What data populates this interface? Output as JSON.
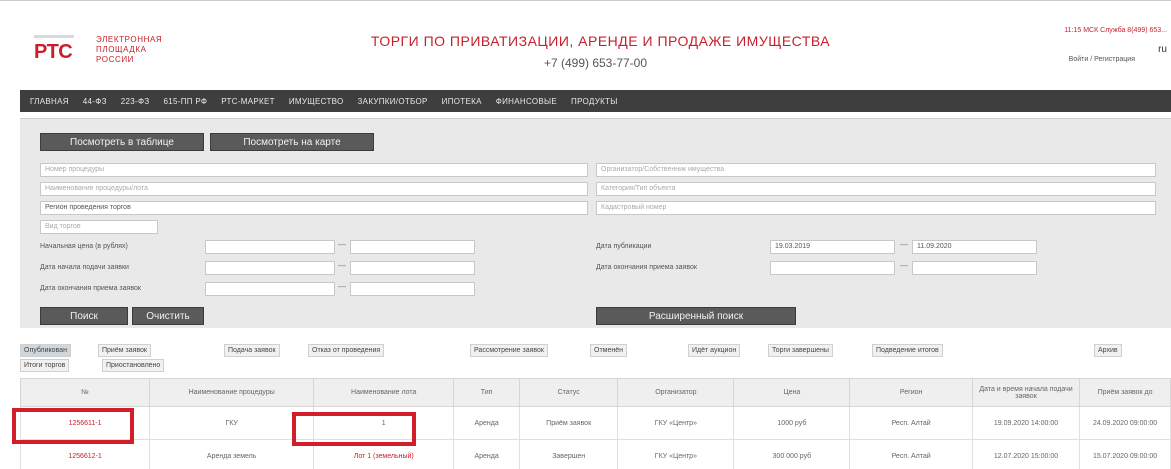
{
  "header": {
    "logo_mark": "РТС",
    "logo_text": [
      "ЭЛЕКТРОННАЯ",
      "ПЛОЩАДКА",
      "РОССИИ"
    ],
    "title": "ТОРГИ ПО ПРИВАТИЗАЦИИ, АРЕНДЕ И ПРОДАЖЕ ИМУЩЕСТВА",
    "phone": "+7 (499) 653-77-00",
    "top_right": "11:15 МСК  Служба 8(499) 653...",
    "lang": "ru",
    "login": "Войти / Регистрация"
  },
  "nav": [
    "ГЛАВНАЯ",
    "44-ФЗ",
    "223-ФЗ",
    "615-ПП РФ",
    "РТС-МАРКЕТ",
    "ИМУЩЕСТВО",
    "ЗАКУПКИ/ОТБОР",
    "ИПОТЕКА",
    "ФИНАНСОВЫЕ",
    "ПРОДУКТЫ"
  ],
  "filters": {
    "table_button": "Посмотреть в таблице",
    "map_button": "Посмотреть на карте",
    "left_fields": [
      "Номер процедуры",
      "Наименование процедуры/лота",
      "Регион проведения торгов",
      "Вид торгов"
    ],
    "right_fields": [
      "Организатор/Собственник имущества",
      "Категория/Тип объекта",
      "Кадастровый номер"
    ],
    "row_labels_left": [
      "Начальная цена (в рублях)",
      "Дата начала подачи заявки",
      "Дата окончания приема заявок"
    ],
    "row_labels_right": [
      "Дата публикации",
      "Дата окончания приема заявок"
    ],
    "date_from": "19.03.2019",
    "date_to": "11.09.2020",
    "search_button": "Поиск",
    "clear_button": "Очистить",
    "advanced_button": "Расширенный поиск"
  },
  "tabs": [
    "Опубликован",
    "Приём заявок",
    "Подача заявок",
    "Отказ от проведения",
    "Рассмотрение заявок",
    "Отменён",
    "Идёт аукцион",
    "Торги завершены",
    "Подведение итогов",
    "Архив",
    "Итоги торгов",
    "Приостановлено"
  ],
  "table": {
    "headers": [
      "№",
      "Наименование процедуры",
      "Наименование лота",
      "Тип",
      "Статус",
      "Организатор",
      "Цена",
      "Регион",
      "Дата и время начала подачи заявок",
      "Приём заявок до"
    ],
    "rows": [
      [
        "1256611-1",
        "ГКУ",
        "1",
        "Аренда",
        "Приём заявок",
        "ГКУ «Центр»",
        "1000 руб",
        "Респ. Алтай",
        "19.09.2020 14:00:00",
        "24.09.2020 09:00:00"
      ],
      [
        "1256612-1",
        "Аренда земель",
        "Лот 1 (земельный)",
        "Аренда",
        "Завершен",
        "ГКУ «Центр»",
        "300 000 руб",
        "Респ. Алтай",
        "12.07.2020 15:00:00",
        "15.07.2020 09:00:00"
      ]
    ]
  }
}
